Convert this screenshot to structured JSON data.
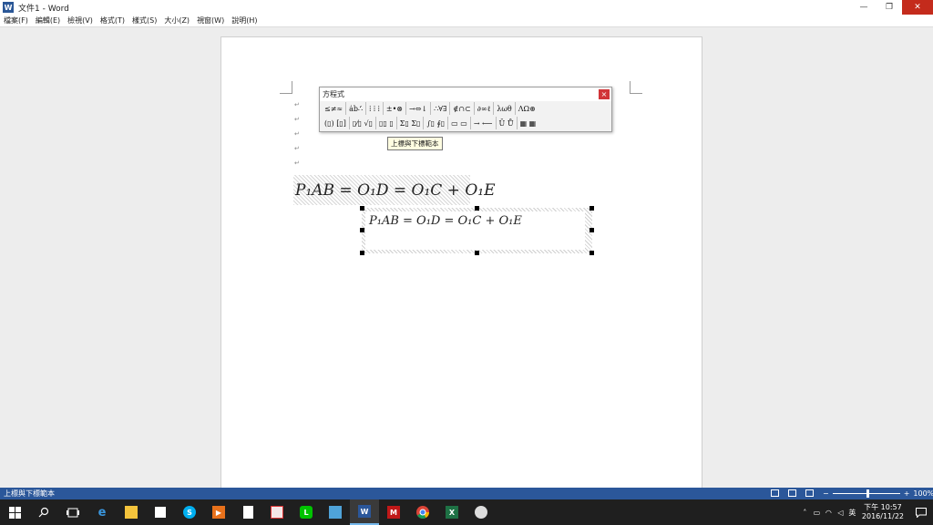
{
  "window": {
    "app_icon": "W",
    "title": "文件1 - Word",
    "controls": {
      "minimize": "—",
      "restore": "❐",
      "close": "✕"
    }
  },
  "menu": [
    "檔案(F)",
    "編輯(E)",
    "檢視(V)",
    "格式(T)",
    "樣式(S)",
    "大小(Z)",
    "視窗(W)",
    "說明(H)"
  ],
  "equation_toolbar": {
    "title": "方程式",
    "close_glyph": "×",
    "row1": [
      "≤≠≈",
      "ȧb∴̇",
      "⁞ ⁞ ⁞",
      "±•⊗",
      "→⇔↓",
      "∴∀∃",
      "∉∩⊂",
      "∂∞ℓ",
      "λωθ",
      "ΛΩ⊛"
    ],
    "row2": [
      "(▯) [▯]",
      "▯⁄▯ √▯",
      "▯▯ ▯",
      "Σ▯ Σ▯",
      "∫▯ ∮▯",
      "▭ ▭",
      "→ ⟵",
      "Ū Ů",
      "▦ ▦"
    ],
    "tooltip": "上標與下標範本"
  },
  "document": {
    "paragraph_mark": "↵",
    "equation1": "P₁AB = O₁D = O₁C + O₁E",
    "equation2": "P₁AB = O₁D = O₁C + O₁E"
  },
  "statusbar": {
    "text": "上標與下標範本",
    "zoom_minus": "−",
    "zoom_plus": "+",
    "zoom_level": "100%",
    "zoom_fraction": 0.5
  },
  "taskbar": {
    "icons": [
      "start-icon",
      "search-icon",
      "task-view-icon",
      "edge-icon",
      "file-explorer-icon",
      "store-icon",
      "skype-icon",
      "media-player-icon",
      "document-icon",
      "paint-icon",
      "line-icon",
      "photos-icon",
      "word-icon",
      "mcafee-icon",
      "chrome-icon",
      "excel-icon",
      "paint-palette-icon"
    ],
    "tray": {
      "ime": "英",
      "time": "下午 10:57",
      "date": "2016/11/22"
    }
  }
}
